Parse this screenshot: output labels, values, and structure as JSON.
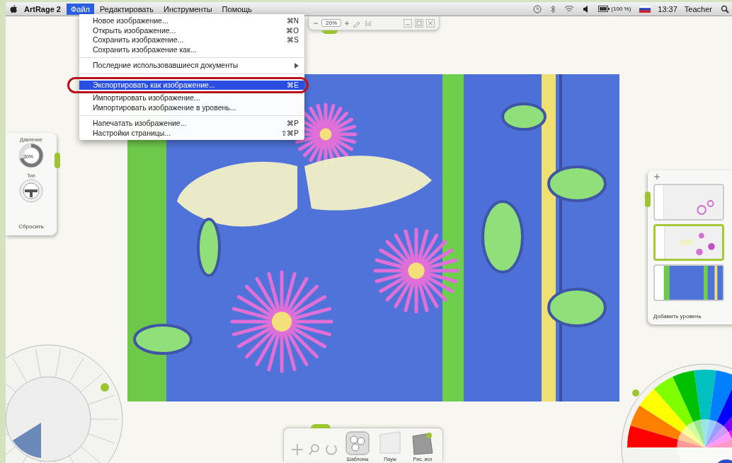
{
  "menubar": {
    "app_name": "ArtRage 2",
    "menus": [
      {
        "label": "Файл",
        "selected": true
      },
      {
        "label": "Редактировать",
        "selected": false
      },
      {
        "label": "Инструменты",
        "selected": false
      },
      {
        "label": "Помощь",
        "selected": false
      }
    ],
    "status": {
      "battery": "(100 %)",
      "time": "13:37",
      "user": "Teacher"
    }
  },
  "toolbar": {
    "zoom": "20%"
  },
  "file_menu": {
    "items": [
      {
        "kind": "item",
        "label": "Новое изображение...",
        "shortcut": "⌘N",
        "selected": false
      },
      {
        "kind": "item",
        "label": "Открыть изображение...",
        "shortcut": "⌘O",
        "selected": false
      },
      {
        "kind": "item",
        "label": "Сохранить изображение...",
        "shortcut": "⌘S",
        "selected": false
      },
      {
        "kind": "item",
        "label": "Сохранить изображение как...",
        "selected": false
      },
      {
        "kind": "separator"
      },
      {
        "kind": "submenu",
        "label": "Последние использовавшиеся документы",
        "selected": false
      },
      {
        "kind": "separator"
      },
      {
        "kind": "item",
        "label": "Экспортировать как изображение...",
        "shortcut": "⌘E",
        "selected": true
      },
      {
        "kind": "item",
        "label": "Импортировать изображение...",
        "selected": false
      },
      {
        "kind": "item",
        "label": "Импортировать изображение в уровень...",
        "selected": false
      },
      {
        "kind": "separator"
      },
      {
        "kind": "item",
        "label": "Напечатать изображение...",
        "shortcut": "⌘P",
        "selected": false
      },
      {
        "kind": "item",
        "label": "Настройки страницы...",
        "shortcut": "⇧⌘P",
        "selected": false
      }
    ]
  },
  "tool_settings": {
    "pressure_label": "Давление",
    "pressure_value": "30%",
    "pressure": {
      "level": 0.7
    },
    "type_label": "Тип",
    "reset": "Сбросить"
  },
  "layers": {
    "items": [
      {
        "kind": "circles",
        "selected": false
      },
      {
        "kind": "butterfly",
        "selected": true
      },
      {
        "kind": "background",
        "selected": false
      }
    ],
    "add": "Добавить уровень"
  },
  "bottom_toolbar": {
    "buttons": [
      {
        "kind": "stencil",
        "label": "Шаблоны"
      },
      {
        "kind": "tracing",
        "label": "Пауы"
      },
      {
        "kind": "reference",
        "label": "Рис. исх"
      }
    ]
  }
}
